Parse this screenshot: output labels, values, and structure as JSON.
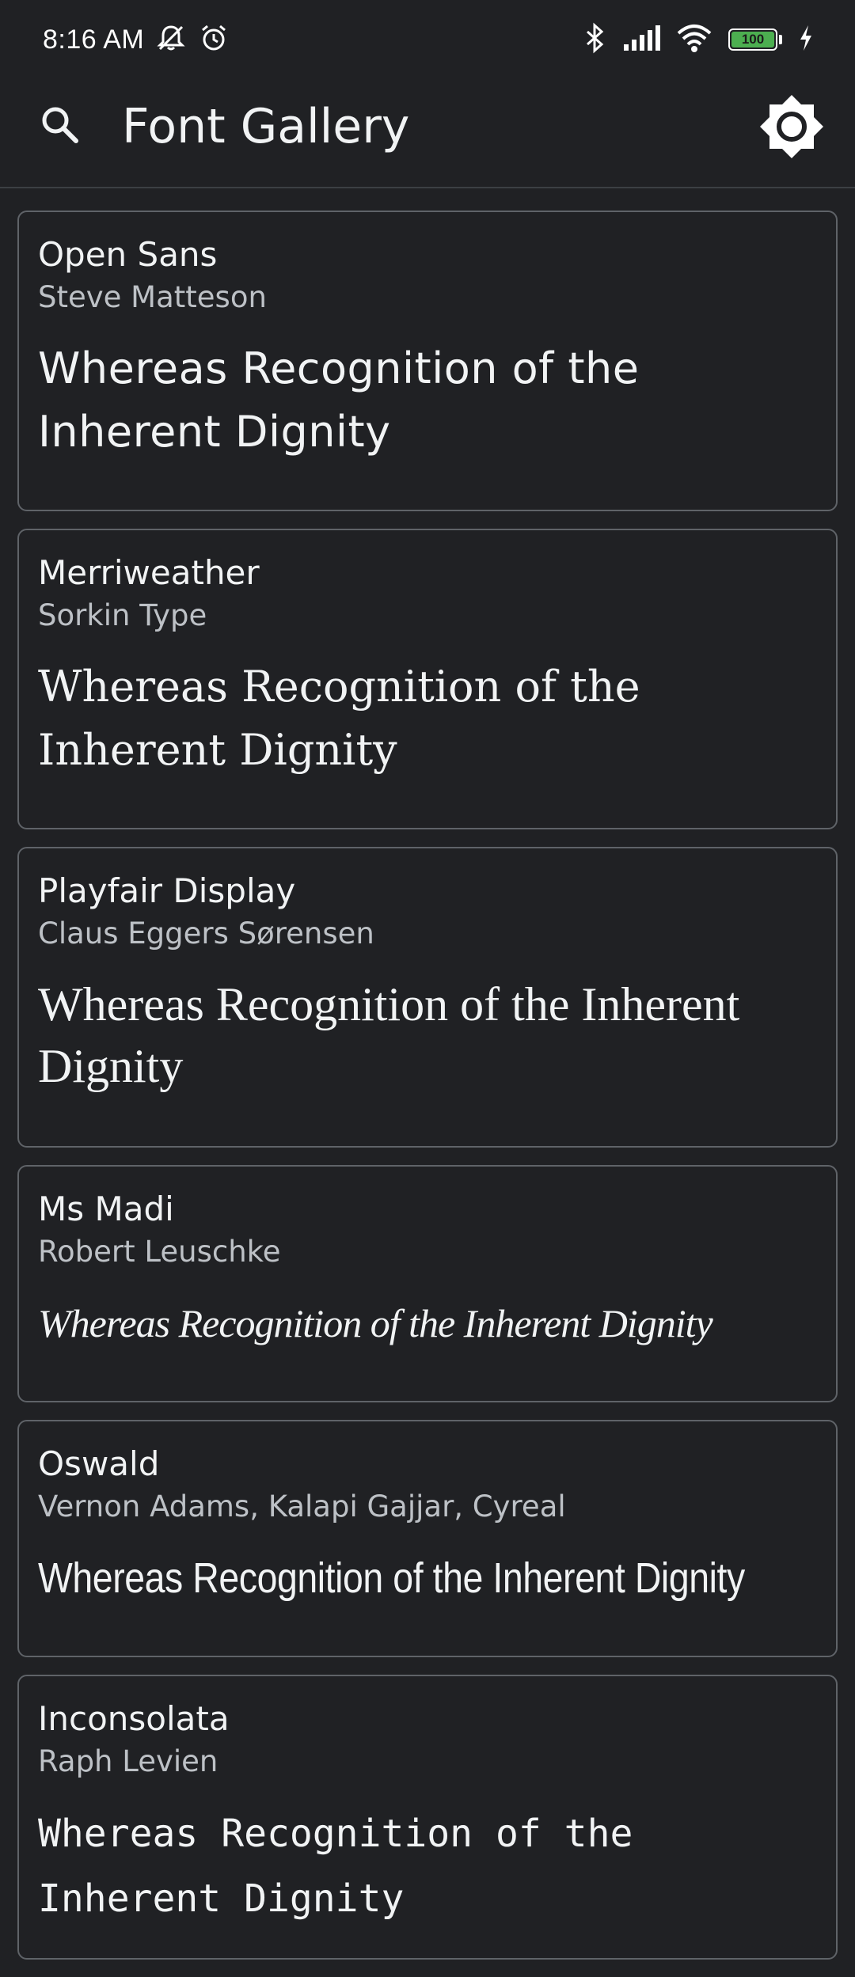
{
  "status_bar": {
    "time": "8:16 AM",
    "battery_level": "100",
    "icons": [
      "mute-icon",
      "alarm-icon",
      "bluetooth-icon",
      "signal-icon",
      "wifi-icon",
      "battery-icon",
      "charging-icon"
    ]
  },
  "app_bar": {
    "title": "Font Gallery",
    "search_icon": "search-icon",
    "theme_icon": "brightness-icon"
  },
  "fonts": [
    {
      "name": "Open Sans",
      "author": "Steve Matteson",
      "sample": "Whereas Recognition of the Inherent Dignity"
    },
    {
      "name": "Merriweather",
      "author": "Sorkin Type",
      "sample": "Whereas Recognition of the Inherent Dignity"
    },
    {
      "name": "Playfair Display",
      "author": "Claus Eggers Sørensen",
      "sample": "Whereas Recognition of the Inherent Dignity"
    },
    {
      "name": "Ms Madi",
      "author": "Robert Leuschke",
      "sample": "Whereas Recognition of the Inherent Dignity"
    },
    {
      "name": "Oswald",
      "author": "Vernon Adams, Kalapi Gajjar, Cyreal",
      "sample": "Whereas Recognition of the Inherent Dignity"
    },
    {
      "name": "Inconsolata",
      "author": "Raph Levien",
      "sample": "Whereas Recognition of the Inherent Dignity"
    }
  ],
  "colors": {
    "background": "#202124",
    "card_border": "#5f6368",
    "text_primary": "#f1f3f4",
    "text_secondary": "#bdc1c6",
    "battery": "#4caf50"
  }
}
